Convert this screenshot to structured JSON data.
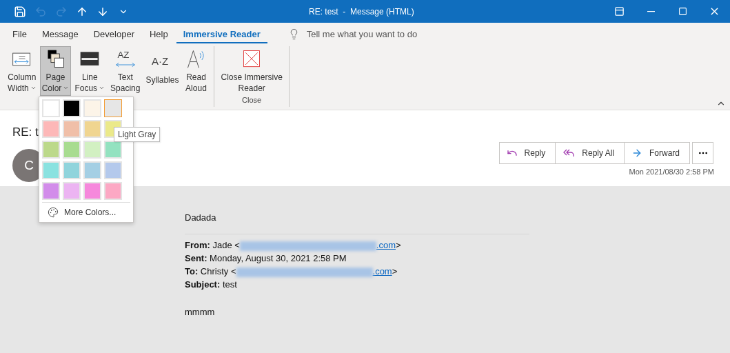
{
  "title_bar": {
    "quick_access": [
      {
        "kind": "save",
        "disabled": false
      },
      {
        "kind": "undo",
        "disabled": true
      },
      {
        "kind": "redo",
        "disabled": true
      },
      {
        "kind": "up",
        "disabled": false
      },
      {
        "kind": "down",
        "disabled": false
      },
      {
        "kind": "customize",
        "disabled": false
      }
    ],
    "title": "RE: test  -  Message (HTML)",
    "controls": [
      {
        "kind": "ribbon-options"
      },
      {
        "kind": "minimize"
      },
      {
        "kind": "maximize"
      },
      {
        "kind": "close"
      }
    ]
  },
  "menu_tabs": [
    {
      "label": "File",
      "selected": false
    },
    {
      "label": "Message",
      "selected": false
    },
    {
      "label": "Developer",
      "selected": false
    },
    {
      "label": "Help",
      "selected": false
    },
    {
      "label": "Immersive Reader",
      "selected": true
    }
  ],
  "tell_me": {
    "placeholder": "Tell me what you want to do"
  },
  "ribbon": {
    "groups": [
      {
        "buttons": [
          {
            "kind": "column-width",
            "lines": [
              "Column",
              "Width"
            ],
            "dropdown": true,
            "pressed": false
          },
          {
            "kind": "page-color",
            "lines": [
              "Page",
              "Color"
            ],
            "dropdown": true,
            "pressed": true
          },
          {
            "kind": "line-focus",
            "lines": [
              "Line",
              "Focus"
            ],
            "dropdown": true,
            "pressed": false
          },
          {
            "kind": "text-spacing",
            "glyph": "AZ",
            "lines": [
              "Text",
              "Spacing"
            ],
            "dropdown": false,
            "pressed": false
          },
          {
            "kind": "syllables",
            "glyph": "A·Z",
            "lines": [
              "Syllables"
            ],
            "dropdown": false,
            "pressed": false
          },
          {
            "kind": "read-aloud",
            "lines": [
              "Read",
              "Aloud"
            ],
            "dropdown": false,
            "pressed": false
          }
        ]
      },
      {
        "label": "Close",
        "buttons": [
          {
            "kind": "close-reader",
            "lines": [
              "Close Immersive",
              "Reader"
            ],
            "dropdown": false,
            "pressed": false
          }
        ]
      }
    ]
  },
  "page_color_menu": {
    "swatches": [
      {
        "color": "#ffffff",
        "selected": false
      },
      {
        "color": "#000000",
        "selected": false
      },
      {
        "color": "#fcf4e8",
        "selected": false
      },
      {
        "color": "#e6e6e6",
        "selected": true
      },
      {
        "color": "#fdb8b8",
        "selected": false
      },
      {
        "color": "#f0bfa8",
        "selected": false
      },
      {
        "color": "#f0d590",
        "selected": false
      },
      {
        "color": "#ebe98a",
        "selected": false
      },
      {
        "color": "#bcd98a",
        "selected": false
      },
      {
        "color": "#a8dc90",
        "selected": false
      },
      {
        "color": "#d2f0c2",
        "selected": false
      },
      {
        "color": "#93e2c0",
        "selected": false
      },
      {
        "color": "#8ae2e0",
        "selected": false
      },
      {
        "color": "#90d4dc",
        "selected": false
      },
      {
        "color": "#a4cfe4",
        "selected": false
      },
      {
        "color": "#b4c9ec",
        "selected": false
      },
      {
        "color": "#d28cea",
        "selected": false
      },
      {
        "color": "#ecb4f2",
        "selected": false
      },
      {
        "color": "#f688dc",
        "selected": false
      },
      {
        "color": "#fca8c4",
        "selected": false
      }
    ],
    "tooltip": "Light Gray",
    "more_colors": "More Colors..."
  },
  "message": {
    "subject": "RE: t",
    "avatar_initial": "C",
    "actions": [
      {
        "kind": "reply",
        "label": "Reply"
      },
      {
        "kind": "reply-all",
        "label": "Reply All"
      },
      {
        "kind": "forward",
        "label": "Forward"
      }
    ],
    "date": "Mon 2021/08/30 2:58 PM"
  },
  "body": {
    "greeting": "Dadada",
    "header_lines": [
      {
        "text": "**From:** Jade <",
        "link": ".com",
        "after": ">",
        "redacted": true
      },
      {
        "text": "**Sent:** Monday, August 30, 2021 2:58 PM",
        "redacted": false
      },
      {
        "text": "**To:** Christy <",
        "link": ".com",
        "after": ">",
        "redacted": true
      },
      {
        "text": "**Subject:** test",
        "redacted": false
      }
    ],
    "closing": "mmmm"
  }
}
